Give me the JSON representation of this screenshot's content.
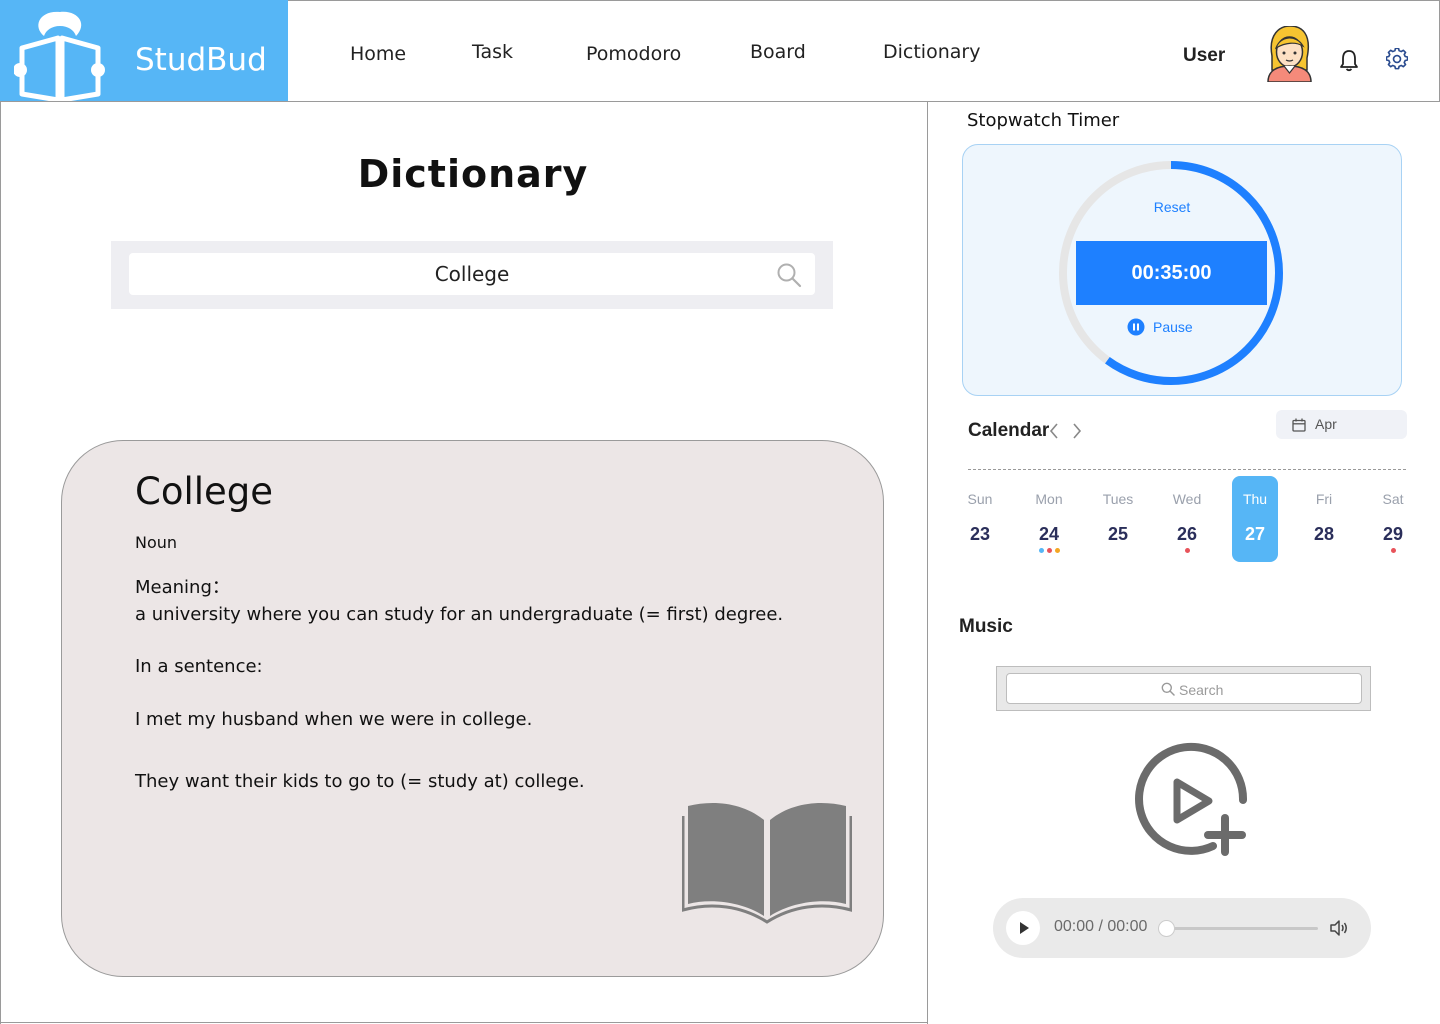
{
  "app": {
    "name": "StudBud"
  },
  "nav": {
    "items": [
      {
        "label": "Home"
      },
      {
        "label": "Task"
      },
      {
        "label": "Pomodoro"
      },
      {
        "label": "Board"
      },
      {
        "label": "Dictionary"
      }
    ],
    "user_label": "User"
  },
  "dictionary": {
    "title": "Dictionary",
    "search_value": "College",
    "entry": {
      "word": "College",
      "part_of_speech": "Noun",
      "meaning_label": "Meaning：",
      "meaning": "a university where you can study for an undergraduate (= first) degree.",
      "sentence_label": "In a sentence:",
      "examples": [
        "I met my husband when we were in college.",
        "They want their kids to go to (= study at) college."
      ]
    }
  },
  "stopwatch": {
    "title": "Stopwatch Timer",
    "reset_label": "Reset",
    "time": "00:35:00",
    "pause_label": "Pause",
    "progress": 0.6
  },
  "calendar": {
    "title": "Calendar",
    "month": "Apr",
    "days": [
      {
        "name": "Sun",
        "num": "23",
        "active": false,
        "dots": []
      },
      {
        "name": "Mon",
        "num": "24",
        "active": false,
        "dots": [
          "#56b6f6",
          "#e8535a",
          "#f4a623"
        ]
      },
      {
        "name": "Tues",
        "num": "25",
        "active": false,
        "dots": []
      },
      {
        "name": "Wed",
        "num": "26",
        "active": false,
        "dots": [
          "#e8535a"
        ]
      },
      {
        "name": "Thu",
        "num": "27",
        "active": true,
        "dots": []
      },
      {
        "name": "Fri",
        "num": "28",
        "active": false,
        "dots": []
      },
      {
        "name": "Sat",
        "num": "29",
        "active": false,
        "dots": [
          "#e8535a"
        ]
      }
    ]
  },
  "music": {
    "title": "Music",
    "search_placeholder": "Search",
    "player_time": "00:00 / 00:00"
  },
  "colors": {
    "brand": "#56b6f6",
    "accent": "#1e80ff",
    "card_bg": "#ece6e6"
  }
}
